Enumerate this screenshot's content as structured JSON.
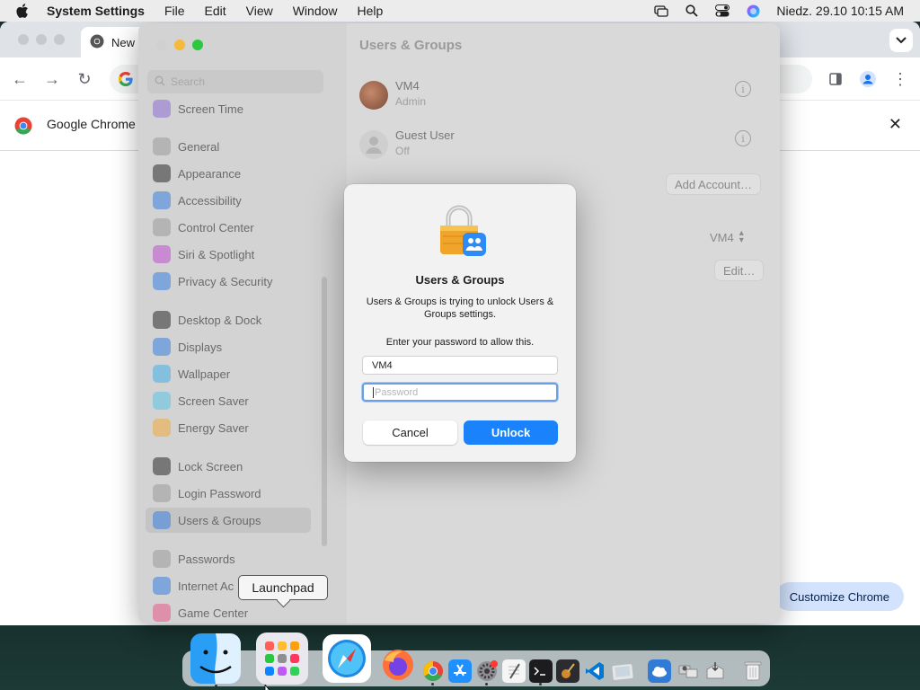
{
  "menubar": {
    "app_name": "System Settings",
    "menus": [
      "File",
      "Edit",
      "View",
      "Window",
      "Help"
    ],
    "datetime": "Niedz. 29.10  10:15 AM"
  },
  "chrome": {
    "tab_title": "New",
    "infobar_text": "Google Chrome i",
    "customize_label": "Customize Chrome"
  },
  "settings": {
    "search_placeholder": "Search",
    "title": "Users & Groups",
    "sidebar": [
      {
        "label": "Screen Time",
        "icon": "hourglass-icon",
        "color": "#8e6fd6"
      },
      {
        "label": "General",
        "icon": "gear-icon",
        "color": "#9a9a9a"
      },
      {
        "label": "Appearance",
        "icon": "appearance-icon",
        "color": "#2b2b2b"
      },
      {
        "label": "Accessibility",
        "icon": "accessibility-icon",
        "color": "#3b82e0"
      },
      {
        "label": "Control Center",
        "icon": "control-center-icon",
        "color": "#9a9a9a"
      },
      {
        "label": "Siri & Spotlight",
        "icon": "siri-icon",
        "color": "#c04fd0"
      },
      {
        "label": "Privacy & Security",
        "icon": "hand-icon",
        "color": "#3b82e0"
      },
      {
        "label": "Desktop & Dock",
        "icon": "dock-icon",
        "color": "#2b2b2b"
      },
      {
        "label": "Displays",
        "icon": "sun-icon",
        "color": "#3b82e0"
      },
      {
        "label": "Wallpaper",
        "icon": "wallpaper-icon",
        "color": "#43b0e8"
      },
      {
        "label": "Screen Saver",
        "icon": "screensaver-icon",
        "color": "#5cc3e6"
      },
      {
        "label": "Energy Saver",
        "icon": "bulb-icon",
        "color": "#f2a93b"
      },
      {
        "label": "Lock Screen",
        "icon": "lock-icon",
        "color": "#2b2b2b"
      },
      {
        "label": "Login Password",
        "icon": "key-icon",
        "color": "#9a9a9a"
      },
      {
        "label": "Users & Groups",
        "icon": "users-icon",
        "color": "#3b82e0"
      },
      {
        "label": "Passwords",
        "icon": "key-icon",
        "color": "#9a9a9a"
      },
      {
        "label": "Internet Ac",
        "icon": "at-icon",
        "color": "#3b82e0"
      },
      {
        "label": "Game Center",
        "icon": "game-center-icon",
        "color": "#e85a8a"
      }
    ],
    "users": [
      {
        "name": "VM4",
        "role": "Admin"
      },
      {
        "name": "Guest User",
        "role": "Off"
      }
    ],
    "add_account": "Add Account…",
    "auto_login_value": "VM4",
    "edit_label": "Edit…",
    "help_label": "?"
  },
  "dialog": {
    "title": "Users & Groups",
    "message": "Users & Groups is trying to unlock Users & Groups settings.",
    "prompt": "Enter your password to allow this.",
    "username_value": "VM4",
    "password_placeholder": "Password",
    "cancel_label": "Cancel",
    "unlock_label": "Unlock"
  },
  "tooltip": "Launchpad",
  "dock": [
    "finder-icon",
    "launchpad-icon",
    "safari-icon",
    "firefox-icon",
    "chrome-icon",
    "app-store-icon",
    "system-settings-icon",
    "textedit-icon",
    "terminal-icon",
    "garageband-icon",
    "vscode-icon",
    "preview-icon",
    "weather-icon",
    "migration-icon",
    "installer-icon",
    "trash-icon"
  ]
}
